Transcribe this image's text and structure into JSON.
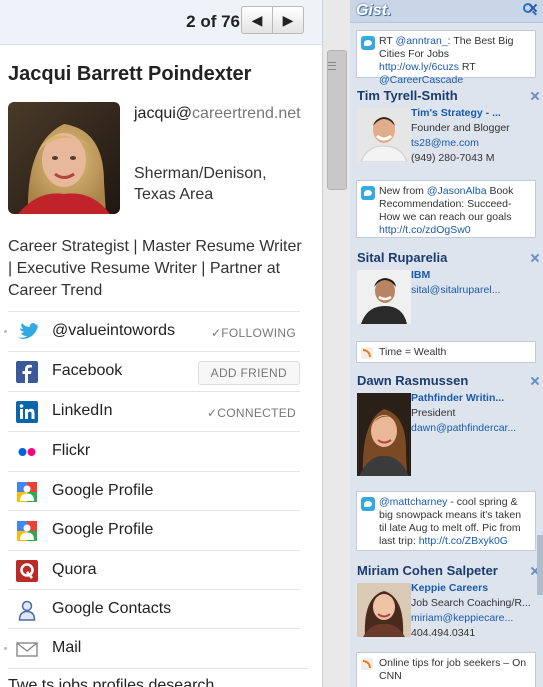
{
  "pager": {
    "text": "2 of 76",
    "prev": "◀",
    "next": "▶"
  },
  "profile": {
    "name": "Jacqui Barrett Poindexter",
    "email_user": "jacqui@",
    "email_domain": "careertrend.net",
    "location": "Sherman/Denison, Texas Area",
    "headline": "Career Strategist | Master Resume Writer | Executive Resume Writer | Partner at Career Trend"
  },
  "networks": [
    {
      "label": "@valueintowords",
      "status": "✓FOLLOWING",
      "icon": "twitter-icon"
    },
    {
      "label": "Facebook",
      "status": "ADD FRIEND",
      "icon": "facebook-icon"
    },
    {
      "label": "LinkedIn",
      "status": "✓CONNECTED",
      "icon": "linkedin-icon"
    },
    {
      "label": "Flickr",
      "status": "",
      "icon": "flickr-icon"
    },
    {
      "label": "Google Profile",
      "status": "",
      "icon": "google-profile-icon"
    },
    {
      "label": "Google Profile",
      "status": "",
      "icon": "google-profile-icon"
    },
    {
      "label": "Quora",
      "status": "",
      "icon": "quora-icon"
    },
    {
      "label": "Google Contacts",
      "status": "",
      "icon": "google-contacts-icon"
    },
    {
      "label": "Mail",
      "status": "",
      "icon": "mail-icon"
    }
  ],
  "bottom_text": "Twe ts jobs profiles desearch",
  "gist": {
    "logo": "Gist.",
    "cards": [
      {
        "pre": "RT ",
        "h1": "@anntran_",
        "mid": ": The Best Big Cities For Jobs ",
        "h2": "http://ow.ly/6cuzs",
        "post": " RT ",
        "h3": "@CareerCascade"
      },
      {
        "pre": "New from ",
        "h1": "@JasonAlba",
        "mid": " Book Recommendation: Succeed- How we can reach our goals ",
        "h2": "http://t.co/zdOgSw0"
      },
      {
        "text": "Time = Wealth"
      },
      {
        "h1": "@mattcharney",
        "mid": " - cool spring & big snowpack means it's taken til late Aug to melt off. Pic from last trip:  ",
        "h2": "http://t.co/ZBxyk0G"
      },
      {
        "text": "Online tips for job seekers – On CNN"
      }
    ],
    "people": [
      {
        "name": "Tim Tyrell-Smith",
        "company": "Tim's Strategy - ...",
        "title": "Founder and Blogger",
        "contact1": "ts28@me.com",
        "contact2": "(949) 280-7043 M"
      },
      {
        "name": "Sital Ruparelia",
        "company": "IBM",
        "title": "",
        "contact1": "sital@sitalruparel...",
        "contact2": ""
      },
      {
        "name": "Dawn Rasmussen",
        "company": "Pathfinder Writin...",
        "title": "President",
        "contact1": "dawn@pathfindercar...",
        "contact2": ""
      },
      {
        "name": "Miriam Cohen Salpeter",
        "company": "Keppie Careers",
        "title": "Job Search Coaching/R...",
        "contact1": "miriam@keppiecare...",
        "contact2": "404.494.0341"
      }
    ]
  },
  "colors": {
    "link": "#1a5aab",
    "gist_bg": "#dde4ee",
    "name_blue": "#1d3c6e"
  }
}
